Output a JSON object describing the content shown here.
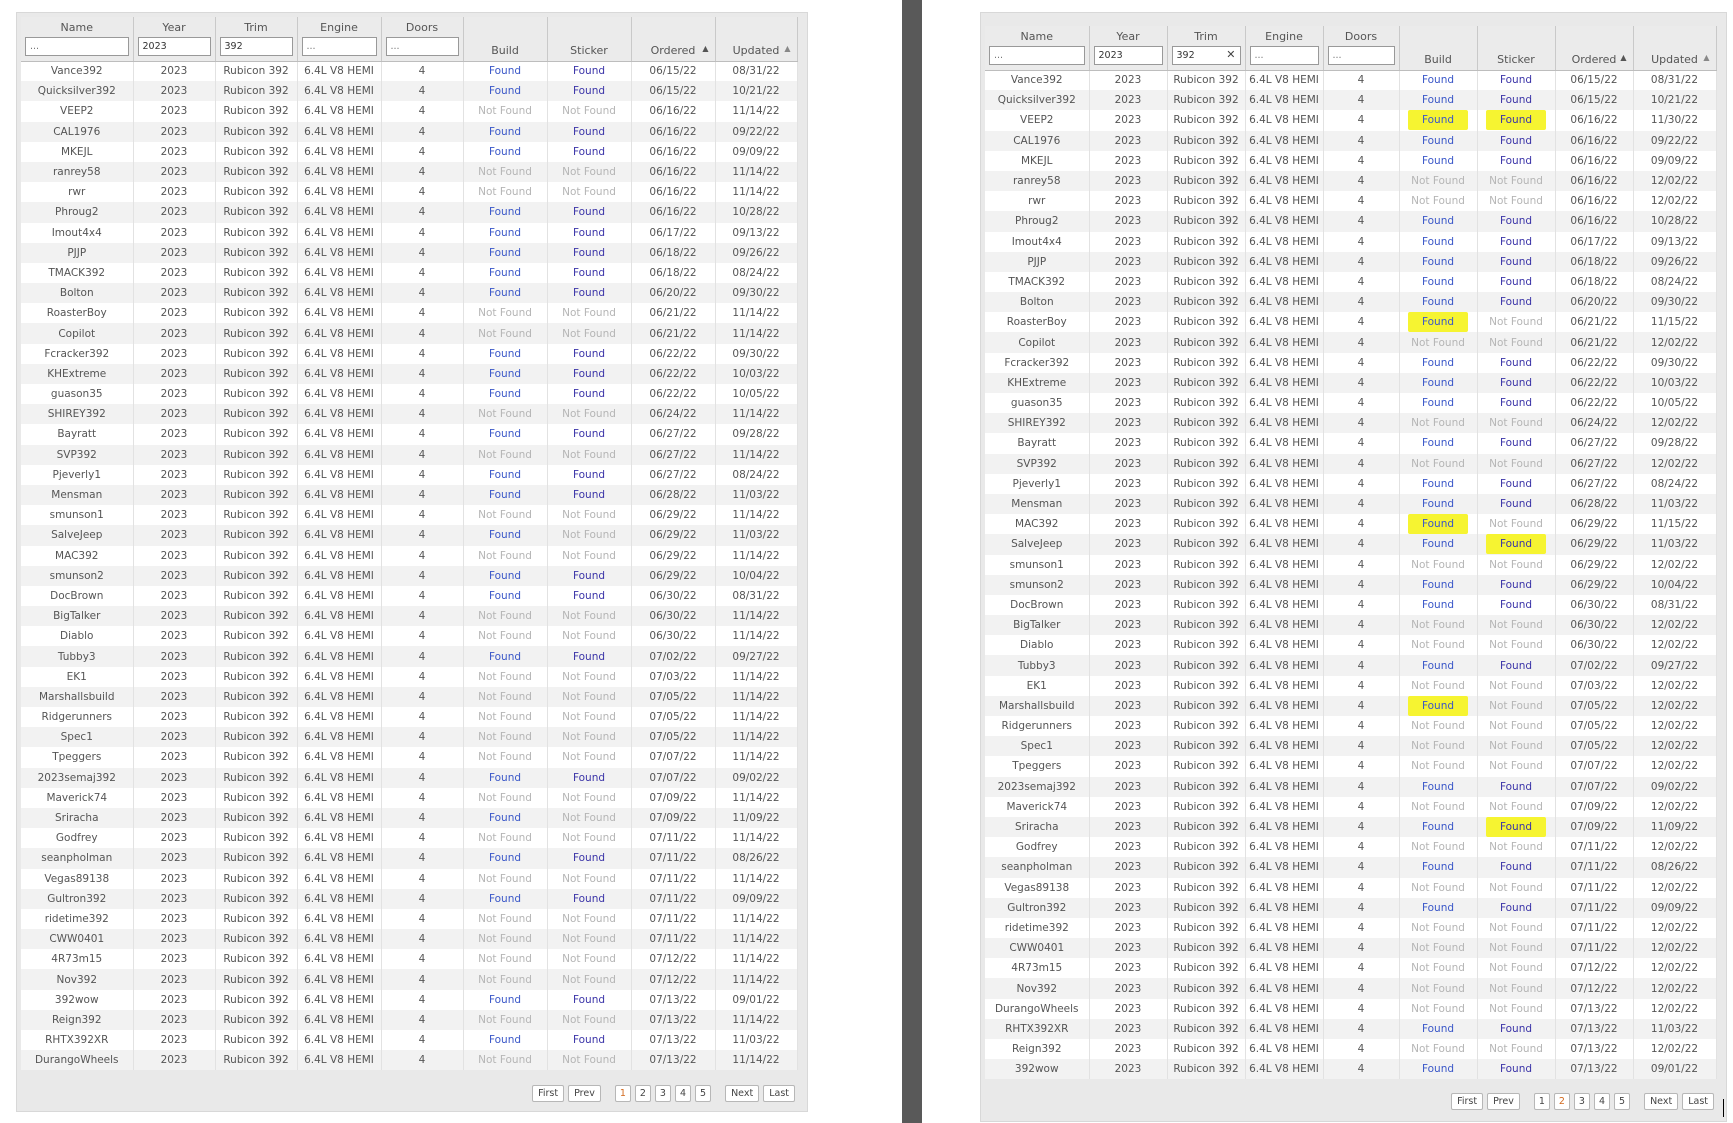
{
  "columns": [
    "Name",
    "Year",
    "Trim",
    "Engine",
    "Doors",
    "Build",
    "Sticker",
    "Ordered",
    "Updated"
  ],
  "filters": {
    "name": {
      "value": "",
      "placeholder": "..."
    },
    "year": {
      "value": "2023",
      "placeholder": ""
    },
    "trim": {
      "value": "392",
      "placeholder": ""
    },
    "engine": {
      "value": "",
      "placeholder": "..."
    },
    "doors": {
      "value": "",
      "placeholder": "..."
    }
  },
  "common": {
    "year": "2023",
    "trim": "Rubicon 392",
    "engine": "6.4L V8 HEMI",
    "doors": "4"
  },
  "pager": {
    "first": "First",
    "prev": "Prev",
    "next": "Next",
    "last": "Last",
    "pages": [
      "1",
      "2",
      "3",
      "4",
      "5"
    ]
  },
  "left_table": {
    "rows": [
      [
        "Vance392",
        "Found",
        "Found",
        "06/15/22",
        "08/31/22"
      ],
      [
        "Quicksilver392",
        "Found",
        "Found",
        "06/15/22",
        "10/21/22"
      ],
      [
        "VEEP2",
        "Not Found",
        "Not Found",
        "06/16/22",
        "11/14/22"
      ],
      [
        "CAL1976",
        "Found",
        "Found",
        "06/16/22",
        "09/22/22"
      ],
      [
        "MKEJL",
        "Found",
        "Found",
        "06/16/22",
        "09/09/22"
      ],
      [
        "ranrey58",
        "Not Found",
        "Not Found",
        "06/16/22",
        "11/14/22"
      ],
      [
        "rwr",
        "Not Found",
        "Not Found",
        "06/16/22",
        "11/14/22"
      ],
      [
        "Phroug2",
        "Found",
        "Found",
        "06/16/22",
        "10/28/22"
      ],
      [
        "Imout4x4",
        "Found",
        "Found",
        "06/17/22",
        "09/13/22"
      ],
      [
        "PJJP",
        "Found",
        "Found",
        "06/18/22",
        "09/26/22"
      ],
      [
        "TMACK392",
        "Found",
        "Found",
        "06/18/22",
        "08/24/22"
      ],
      [
        "Bolton",
        "Found",
        "Found",
        "06/20/22",
        "09/30/22"
      ],
      [
        "RoasterBoy",
        "Not Found",
        "Not Found",
        "06/21/22",
        "11/14/22"
      ],
      [
        "Copilot",
        "Not Found",
        "Not Found",
        "06/21/22",
        "11/14/22"
      ],
      [
        "Fcracker392",
        "Found",
        "Found",
        "06/22/22",
        "09/30/22"
      ],
      [
        "KHExtreme",
        "Found",
        "Found",
        "06/22/22",
        "10/03/22"
      ],
      [
        "guason35",
        "Found",
        "Found",
        "06/22/22",
        "10/05/22"
      ],
      [
        "SHIREY392",
        "Not Found",
        "Not Found",
        "06/24/22",
        "11/14/22"
      ],
      [
        "Bayratt",
        "Found",
        "Found",
        "06/27/22",
        "09/28/22"
      ],
      [
        "SVP392",
        "Not Found",
        "Not Found",
        "06/27/22",
        "11/14/22"
      ],
      [
        "Pjeverly1",
        "Found",
        "Found",
        "06/27/22",
        "08/24/22"
      ],
      [
        "Mensman",
        "Found",
        "Found",
        "06/28/22",
        "11/03/22"
      ],
      [
        "smunson1",
        "Not Found",
        "Not Found",
        "06/29/22",
        "11/14/22"
      ],
      [
        "SalveJeep",
        "Found",
        "Not Found",
        "06/29/22",
        "11/03/22"
      ],
      [
        "MAC392",
        "Not Found",
        "Not Found",
        "06/29/22",
        "11/14/22"
      ],
      [
        "smunson2",
        "Found",
        "Found",
        "06/29/22",
        "10/04/22"
      ],
      [
        "DocBrown",
        "Found",
        "Found",
        "06/30/22",
        "08/31/22"
      ],
      [
        "BigTalker",
        "Not Found",
        "Not Found",
        "06/30/22",
        "11/14/22"
      ],
      [
        "Diablo",
        "Not Found",
        "Not Found",
        "06/30/22",
        "11/14/22"
      ],
      [
        "Tubby3",
        "Found",
        "Found",
        "07/02/22",
        "09/27/22"
      ],
      [
        "EK1",
        "Not Found",
        "Not Found",
        "07/03/22",
        "11/14/22"
      ],
      [
        "Marshallsbuild",
        "Not Found",
        "Not Found",
        "07/05/22",
        "11/14/22"
      ],
      [
        "Ridgerunners",
        "Not Found",
        "Not Found",
        "07/05/22",
        "11/14/22"
      ],
      [
        "Spec1",
        "Not Found",
        "Not Found",
        "07/05/22",
        "11/14/22"
      ],
      [
        "Tpeggers",
        "Not Found",
        "Not Found",
        "07/07/22",
        "11/14/22"
      ],
      [
        "2023semaj392",
        "Found",
        "Found",
        "07/07/22",
        "09/02/22"
      ],
      [
        "Maverick74",
        "Not Found",
        "Not Found",
        "07/09/22",
        "11/14/22"
      ],
      [
        "Sriracha",
        "Found",
        "Not Found",
        "07/09/22",
        "11/09/22"
      ],
      [
        "Godfrey",
        "Not Found",
        "Not Found",
        "07/11/22",
        "11/14/22"
      ],
      [
        "seanpholman",
        "Found",
        "Found",
        "07/11/22",
        "08/26/22"
      ],
      [
        "Vegas89138",
        "Not Found",
        "Not Found",
        "07/11/22",
        "11/14/22"
      ],
      [
        "Gultron392",
        "Found",
        "Found",
        "07/11/22",
        "09/09/22"
      ],
      [
        "ridetime392",
        "Not Found",
        "Not Found",
        "07/11/22",
        "11/14/22"
      ],
      [
        "CWW0401",
        "Not Found",
        "Not Found",
        "07/11/22",
        "11/14/22"
      ],
      [
        "4R73m15",
        "Not Found",
        "Not Found",
        "07/12/22",
        "11/14/22"
      ],
      [
        "Nov392",
        "Not Found",
        "Not Found",
        "07/12/22",
        "11/14/22"
      ],
      [
        "392wow",
        "Found",
        "Found",
        "07/13/22",
        "09/01/22"
      ],
      [
        "Reign392",
        "Not Found",
        "Not Found",
        "07/13/22",
        "11/14/22"
      ],
      [
        "RHTX392XR",
        "Found",
        "Found",
        "07/13/22",
        "11/03/22"
      ],
      [
        "DurangoWheels",
        "Not Found",
        "Not Found",
        "07/13/22",
        "11/14/22"
      ]
    ]
  },
  "right_table": {
    "rows": [
      [
        "Vance392",
        "Found",
        "Found",
        "06/15/22",
        "08/31/22"
      ],
      [
        "Quicksilver392",
        "Found",
        "Found",
        "06/15/22",
        "10/21/22"
      ],
      [
        "VEEP2",
        "Found",
        "Found",
        "06/16/22",
        "11/30/22"
      ],
      [
        "CAL1976",
        "Found",
        "Found",
        "06/16/22",
        "09/22/22"
      ],
      [
        "MKEJL",
        "Found",
        "Found",
        "06/16/22",
        "09/09/22"
      ],
      [
        "ranrey58",
        "Not Found",
        "Not Found",
        "06/16/22",
        "12/02/22"
      ],
      [
        "rwr",
        "Not Found",
        "Not Found",
        "06/16/22",
        "12/02/22"
      ],
      [
        "Phroug2",
        "Found",
        "Found",
        "06/16/22",
        "10/28/22"
      ],
      [
        "Imout4x4",
        "Found",
        "Found",
        "06/17/22",
        "09/13/22"
      ],
      [
        "PJJP",
        "Found",
        "Found",
        "06/18/22",
        "09/26/22"
      ],
      [
        "TMACK392",
        "Found",
        "Found",
        "06/18/22",
        "08/24/22"
      ],
      [
        "Bolton",
        "Found",
        "Found",
        "06/20/22",
        "09/30/22"
      ],
      [
        "RoasterBoy",
        "Found",
        "Not Found",
        "06/21/22",
        "11/15/22"
      ],
      [
        "Copilot",
        "Not Found",
        "Not Found",
        "06/21/22",
        "12/02/22"
      ],
      [
        "Fcracker392",
        "Found",
        "Found",
        "06/22/22",
        "09/30/22"
      ],
      [
        "KHExtreme",
        "Found",
        "Found",
        "06/22/22",
        "10/03/22"
      ],
      [
        "guason35",
        "Found",
        "Found",
        "06/22/22",
        "10/05/22"
      ],
      [
        "SHIREY392",
        "Not Found",
        "Not Found",
        "06/24/22",
        "12/02/22"
      ],
      [
        "Bayratt",
        "Found",
        "Found",
        "06/27/22",
        "09/28/22"
      ],
      [
        "SVP392",
        "Not Found",
        "Not Found",
        "06/27/22",
        "12/02/22"
      ],
      [
        "Pjeverly1",
        "Found",
        "Found",
        "06/27/22",
        "08/24/22"
      ],
      [
        "Mensman",
        "Found",
        "Found",
        "06/28/22",
        "11/03/22"
      ],
      [
        "MAC392",
        "Found",
        "Not Found",
        "06/29/22",
        "11/15/22"
      ],
      [
        "SalveJeep",
        "Found",
        "Found",
        "06/29/22",
        "11/03/22"
      ],
      [
        "smunson1",
        "Not Found",
        "Not Found",
        "06/29/22",
        "12/02/22"
      ],
      [
        "smunson2",
        "Found",
        "Found",
        "06/29/22",
        "10/04/22"
      ],
      [
        "DocBrown",
        "Found",
        "Found",
        "06/30/22",
        "08/31/22"
      ],
      [
        "BigTalker",
        "Not Found",
        "Not Found",
        "06/30/22",
        "12/02/22"
      ],
      [
        "Diablo",
        "Not Found",
        "Not Found",
        "06/30/22",
        "12/02/22"
      ],
      [
        "Tubby3",
        "Found",
        "Found",
        "07/02/22",
        "09/27/22"
      ],
      [
        "EK1",
        "Not Found",
        "Not Found",
        "07/03/22",
        "12/02/22"
      ],
      [
        "Marshallsbuild",
        "Found",
        "Not Found",
        "07/05/22",
        "12/02/22"
      ],
      [
        "Ridgerunners",
        "Not Found",
        "Not Found",
        "07/05/22",
        "12/02/22"
      ],
      [
        "Spec1",
        "Not Found",
        "Not Found",
        "07/05/22",
        "12/02/22"
      ],
      [
        "Tpeggers",
        "Not Found",
        "Not Found",
        "07/07/22",
        "12/02/22"
      ],
      [
        "2023semaj392",
        "Found",
        "Found",
        "07/07/22",
        "09/02/22"
      ],
      [
        "Maverick74",
        "Not Found",
        "Not Found",
        "07/09/22",
        "12/02/22"
      ],
      [
        "Sriracha",
        "Found",
        "Found",
        "07/09/22",
        "11/09/22"
      ],
      [
        "Godfrey",
        "Not Found",
        "Not Found",
        "07/11/22",
        "12/02/22"
      ],
      [
        "seanpholman",
        "Found",
        "Found",
        "07/11/22",
        "08/26/22"
      ],
      [
        "Vegas89138",
        "Not Found",
        "Not Found",
        "07/11/22",
        "12/02/22"
      ],
      [
        "Gultron392",
        "Found",
        "Found",
        "07/11/22",
        "09/09/22"
      ],
      [
        "ridetime392",
        "Not Found",
        "Not Found",
        "07/11/22",
        "12/02/22"
      ],
      [
        "CWW0401",
        "Not Found",
        "Not Found",
        "07/11/22",
        "12/02/22"
      ],
      [
        "4R73m15",
        "Not Found",
        "Not Found",
        "07/12/22",
        "12/02/22"
      ],
      [
        "Nov392",
        "Not Found",
        "Not Found",
        "07/12/22",
        "12/02/22"
      ],
      [
        "DurangoWheels",
        "Not Found",
        "Not Found",
        "07/13/22",
        "12/02/22"
      ],
      [
        "RHTX392XR",
        "Found",
        "Found",
        "07/13/22",
        "11/03/22"
      ],
      [
        "Reign392",
        "Not Found",
        "Not Found",
        "07/13/22",
        "12/02/22"
      ],
      [
        "392wow",
        "Found",
        "Found",
        "07/13/22",
        "09/01/22"
      ]
    ],
    "highlights": [
      [
        2,
        "build"
      ],
      [
        2,
        "sticker"
      ],
      [
        12,
        "build"
      ],
      [
        22,
        "build"
      ],
      [
        23,
        "sticker"
      ],
      [
        31,
        "build"
      ],
      [
        37,
        "sticker"
      ]
    ]
  },
  "colors": {
    "found_build": "#3a57c8",
    "found_sticker": "#3b34a8",
    "not_found": "#b5b5b5",
    "highlight": "#f6f431",
    "divider": "#595959"
  }
}
